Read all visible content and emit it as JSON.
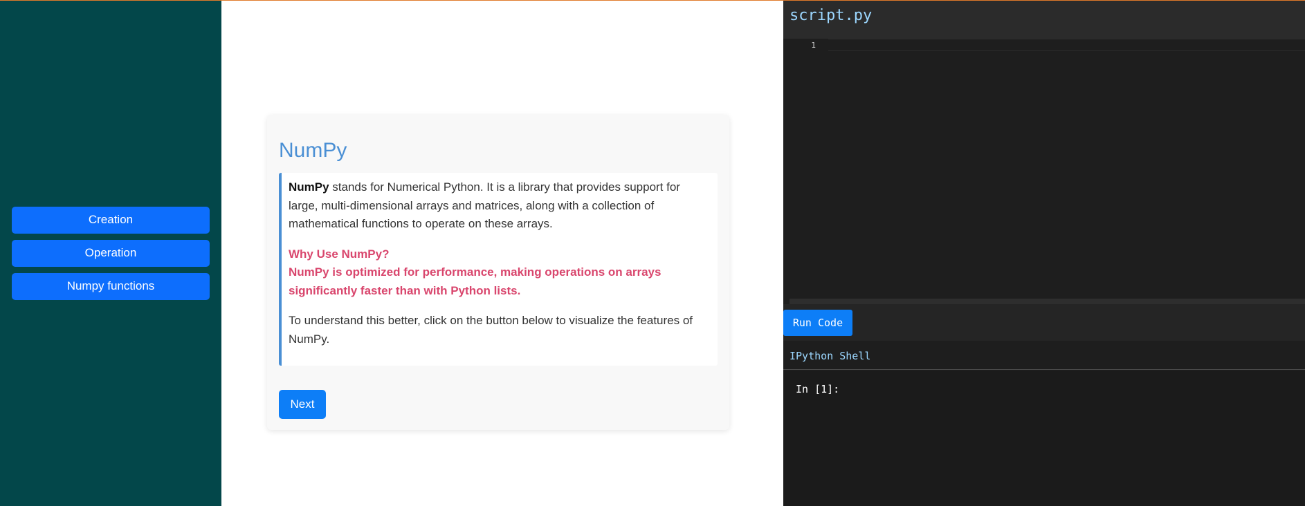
{
  "sidebar": {
    "items": [
      {
        "label": "Creation"
      },
      {
        "label": "Operation"
      },
      {
        "label": "Numpy functions"
      }
    ]
  },
  "card": {
    "title": "NumPy",
    "intro_bold": "NumPy",
    "intro_rest": " stands for Numerical Python. It is a library that provides support for large, multi-dimensional arrays and matrices, along with a collection of mathematical functions to operate on these arrays.",
    "why_heading": "Why Use NumPy?",
    "why_text": "NumPy is optimized for performance, making operations on arrays significantly faster than with Python lists.",
    "outro": "To understand this better, click on the button below to visualize the features of NumPy.",
    "next_label": "Next"
  },
  "editor": {
    "file_name": "script.py",
    "line_number": "1",
    "run_label": "Run Code"
  },
  "shell": {
    "title": "IPython Shell",
    "prompt": "In [1]:"
  },
  "colors": {
    "sidebar_bg": "#03474a",
    "primary_button": "#0d6efd",
    "title_blue": "#4a8fd4",
    "highlight_pink": "#d9466d",
    "editor_bg": "#1e1e1e",
    "file_name_color": "#9cd7ff",
    "top_accent": "#e07a2a"
  }
}
